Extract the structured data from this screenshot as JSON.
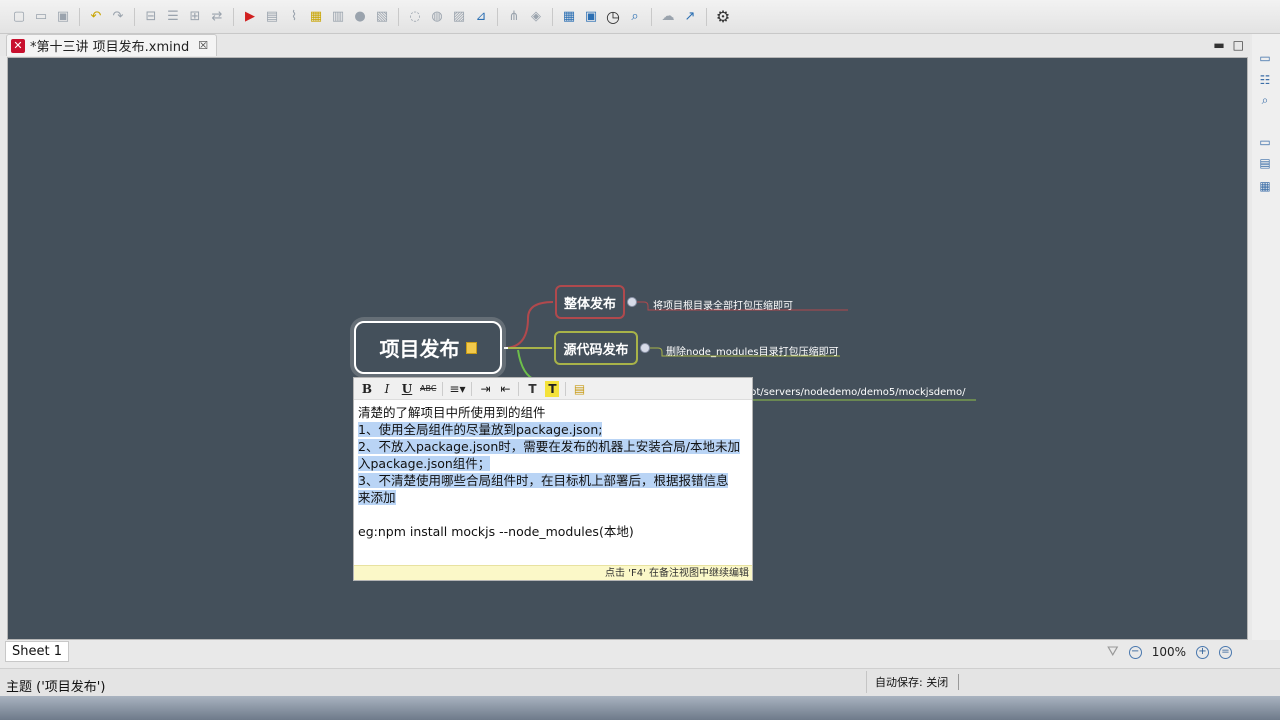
{
  "toolbar": {
    "icons": [
      "new-icon",
      "open-icon",
      "save-icon",
      "undo-icon",
      "redo-icon",
      "insert-topic-icon",
      "insert-subtopic-icon",
      "boundary-icon",
      "summary-icon",
      "relationship-icon",
      "present-icon",
      "export-icon",
      "attachment-icon",
      "label-icon",
      "note-icon",
      "marker-icon",
      "image-icon",
      "hyperlink-icon",
      "idea-icon",
      "outline-icon",
      "map-icon",
      "clock-icon",
      "zoom-icon",
      "upload-icon",
      "share-icon",
      "settings-icon"
    ]
  },
  "editor_tab": {
    "title": "*第十三讲 项目发布.xmind",
    "close_glyph": "☒"
  },
  "window_controls": {
    "minimize": "▬",
    "maximize": "□"
  },
  "mindmap": {
    "central_topic": "项目发布",
    "branches": [
      {
        "label": "整体发布",
        "leaf": "将项目根目录全部打包压缩即可",
        "color": "#b0494d"
      },
      {
        "label": "源代码发布",
        "leaf": "删除node_modules目录打包压缩即可",
        "color": "#a8b349"
      }
    ],
    "partial_leaf": "pt/servers/nodedemo/demo5/mockjsdemo/",
    "partial_leaf_color": "#8fbf4a"
  },
  "notes": {
    "toolbar": {
      "bold": "B",
      "italic": "I",
      "underline": "U",
      "strike": "ABC",
      "align": "≡▾",
      "indent": "⇥",
      "outdent": "⇤",
      "text_color": "T",
      "highlight": "T",
      "note": "▤"
    },
    "lines": [
      "清楚的了解项目中所使用到的组件",
      "1、使用全局组件的尽量放到package.json;",
      "2、不放入package.json时，需要在发布的机器上安装合局/本地未加",
      "入package.json组件；",
      "3、不清楚使用哪些合局组件时，在目标机上部署后，根据报错信息",
      "来添加",
      "eg:npm install mockjs --node_modules(本地)"
    ],
    "footer": "点击 'F4' 在备注视图中继续编辑"
  },
  "sheet_tab": "Sheet 1",
  "zoom": {
    "level": "100%",
    "minus": "−",
    "plus": "+",
    "fit": "="
  },
  "status": {
    "selection": "主题 ('项目发布')",
    "autosave": "自动保存: 关闭"
  },
  "colors": {
    "canvas": "#44505b",
    "selection_highlight": "#b9d4f5",
    "notes_footer": "#fbf8c8"
  }
}
